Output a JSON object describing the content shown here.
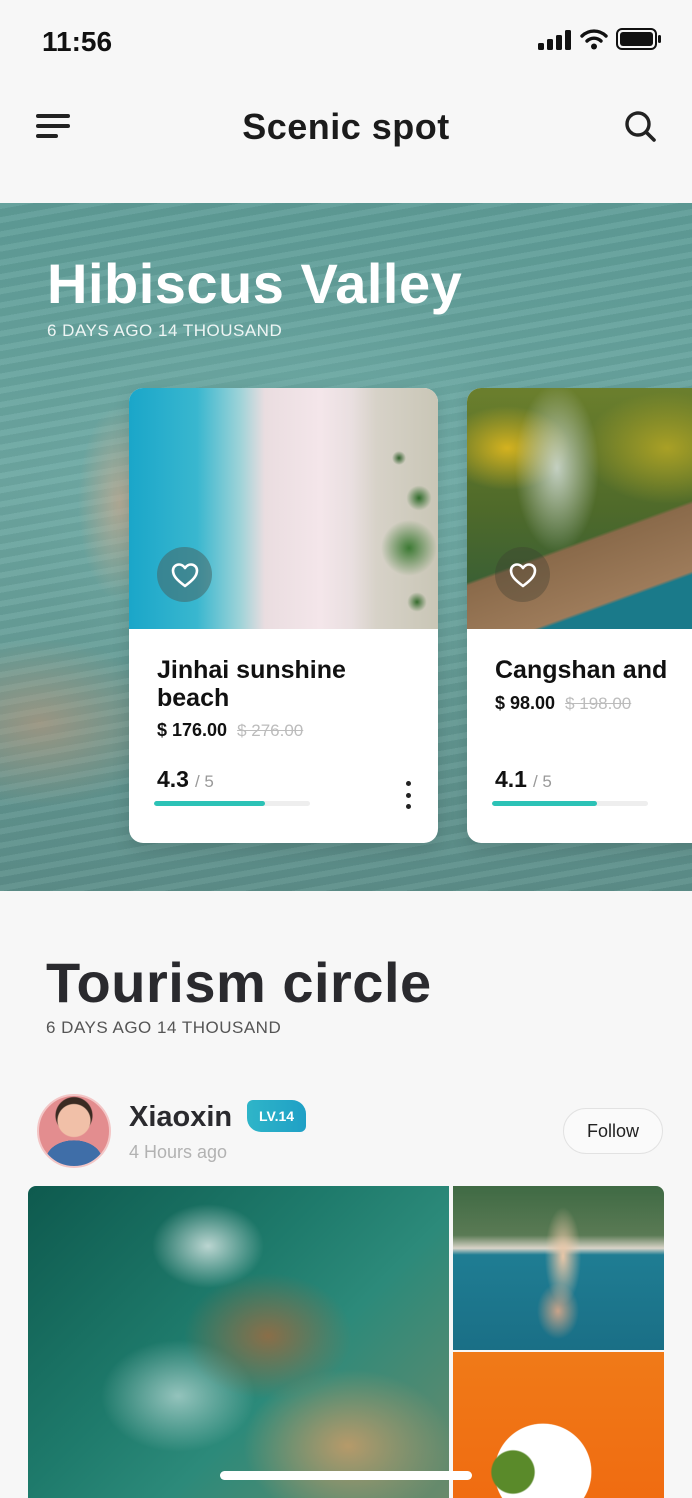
{
  "status_bar": {
    "time": "11:56"
  },
  "header": {
    "title": "Scenic spot",
    "menu_icon": "menu-icon",
    "search_icon": "search-icon"
  },
  "hero": {
    "title": "Hibiscus Valley",
    "subtitle": "6 DAYS AGO 14 THOUSAND",
    "cards": [
      {
        "name": "Jinhai sunshine beach",
        "price": "$ 176.00",
        "old_price": "$ 276.00",
        "rating": "4.3",
        "rating_max": "/ 5",
        "rating_value": 4.3
      },
      {
        "name": "Cangshan and",
        "price": "$ 98.00",
        "old_price": "$ 198.00",
        "rating": "4.1",
        "rating_max": "/ 5",
        "rating_value": 4.1
      }
    ]
  },
  "tourism": {
    "title": "Tourism circle",
    "subtitle": "6 DAYS AGO 14 THOUSAND",
    "post": {
      "username": "Xiaoxin",
      "level": "LV.14",
      "time": "4 Hours ago",
      "follow_label": "Follow"
    }
  },
  "colors": {
    "accent": "#2cc2b6",
    "badge": "#1fa0c6",
    "text": "#2a2a2e"
  }
}
